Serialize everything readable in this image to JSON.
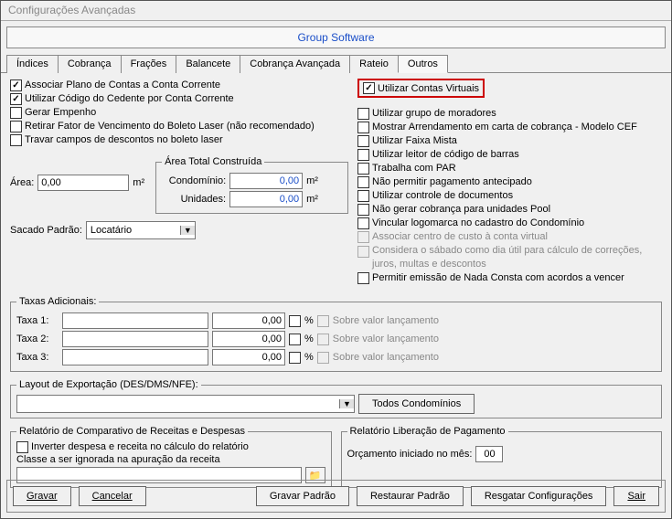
{
  "window_title": "Configurações Avançadas",
  "banner": "Group Software",
  "tabs": [
    "Índices",
    "Cobrança",
    "Frações",
    "Balancete",
    "Cobrança Avançada",
    "Rateio",
    "Outros"
  ],
  "active_tab": "Outros",
  "left_checks": [
    {
      "label": "Associar Plano de Contas a Conta Corrente",
      "checked": true
    },
    {
      "label": "Utilizar Código do Cedente por Conta Corrente",
      "checked": true
    },
    {
      "label": "Gerar Empenho",
      "checked": false
    },
    {
      "label": "Retirar Fator de Vencimento do Boleto Laser (não recomendado)",
      "checked": false
    },
    {
      "label": "Travar campos de descontos no boleto laser",
      "checked": false
    }
  ],
  "area_label": "Área:",
  "area_value": "0,00",
  "area_unit": "m²",
  "area_group_title": "Área Total Construída",
  "area_cond_label": "Condomínio:",
  "area_cond_value": "0,00",
  "area_unid_label": "Unidades:",
  "area_unid_value": "0,00",
  "sacado_label": "Sacado Padrão:",
  "sacado_value": "Locatário",
  "highlight_label": "Utilizar Contas Virtuais",
  "right_checks": [
    {
      "label": "Utilizar grupo de moradores",
      "checked": false,
      "disabled": false
    },
    {
      "label": "Mostrar Arrendamento em carta de cobrança - Modelo CEF",
      "checked": false,
      "disabled": false
    },
    {
      "label": "Utilizar Faixa Mista",
      "checked": false,
      "disabled": false
    },
    {
      "label": "Utilizar leitor de código de barras",
      "checked": false,
      "disabled": false
    },
    {
      "label": "Trabalha com PAR",
      "checked": false,
      "disabled": false
    },
    {
      "label": "Não permitir pagamento antecipado",
      "checked": false,
      "disabled": false
    },
    {
      "label": "Utilizar controle de documentos",
      "checked": false,
      "disabled": false
    },
    {
      "label": "Não gerar cobrança para unidades Pool",
      "checked": false,
      "disabled": false
    },
    {
      "label": "Vincular logomarca no cadastro do Condomínio",
      "checked": false,
      "disabled": false
    },
    {
      "label": "Associar centro de custo à conta virtual",
      "checked": false,
      "disabled": true
    },
    {
      "label": "Considera o sábado como dia útil para cálculo de correções, juros, multas e descontos",
      "checked": false,
      "disabled": true
    },
    {
      "label": "Permitir emissão de Nada Consta com acordos a vencer",
      "checked": false,
      "disabled": false
    }
  ],
  "taxas_title": "Taxas Adicionais:",
  "taxa1_label": "Taxa 1:",
  "taxa1_name": "",
  "taxa1_value": "0,00",
  "taxa1_pct": "%",
  "taxa1_note": "Sobre valor lançamento",
  "taxa2_label": "Taxa 2:",
  "taxa2_name": "",
  "taxa2_value": "0,00",
  "taxa2_pct": "%",
  "taxa2_note": "Sobre valor lançamento",
  "taxa3_label": "Taxa 3:",
  "taxa3_name": "",
  "taxa3_value": "0,00",
  "taxa3_pct": "%",
  "taxa3_note": "Sobre valor lançamento",
  "layout_title": "Layout de Exportação (DES/DMS/NFE):",
  "layout_value": "",
  "layout_btn": "Todos Condomínios",
  "rel_title": "Relatório de Comparativo de Receitas e Despesas",
  "rel_check": "Inverter despesa e receita no cálculo do relatório",
  "rel_label": "Classe a ser ignorada na apuração da receita",
  "rel_value": "",
  "lib_title": "Relatório Liberação de Pagamento",
  "lib_label": "Orçamento iniciado no mês:",
  "lib_value": "00",
  "footer": {
    "gravar": "Gravar",
    "cancelar": "Cancelar",
    "gravar_padrao": "Gravar Padrão",
    "restaurar": "Restaurar Padrão",
    "resgatar": "Resgatar Configurações",
    "sair": "Sair"
  }
}
